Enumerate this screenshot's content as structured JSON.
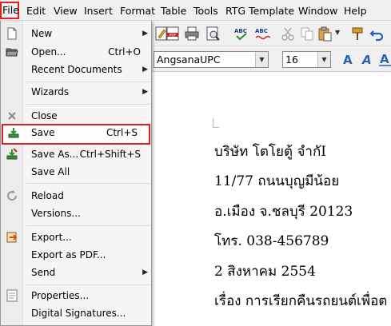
{
  "menubar": {
    "items": [
      "File",
      "Edit",
      "View",
      "Insert",
      "Format",
      "Table",
      "Tools",
      "RTG Template",
      "Window",
      "Help"
    ]
  },
  "toolbar": {
    "font_name": "AngsanaUPC",
    "font_size": "16"
  },
  "file_menu": {
    "new": "New",
    "open": "Open...",
    "open_shortcut": "Ctrl+O",
    "recent_documents": "Recent Documents",
    "wizards": "Wizards",
    "close": "Close",
    "save": "Save",
    "save_shortcut": "Ctrl+S",
    "save_as": "Save As...",
    "save_as_shortcut": "Ctrl+Shift+S",
    "save_all": "Save All",
    "reload": "Reload",
    "versions": "Versions...",
    "export": "Export...",
    "export_pdf": "Export as PDF...",
    "send": "Send",
    "properties": "Properties...",
    "digital_signatures": "Digital Signatures..."
  },
  "document": {
    "lines": [
      "บริษัท โตโยตู้ จำกัI",
      "11/77 ถนนบุญมีน้อย",
      "อ.เมือง จ.ชลบุรี 20123",
      "โทร. 038-456789",
      "2 สิงหาคม 2554",
      "เรื่อง การเรียกคืนรถยนต์เพื่อต"
    ]
  }
}
